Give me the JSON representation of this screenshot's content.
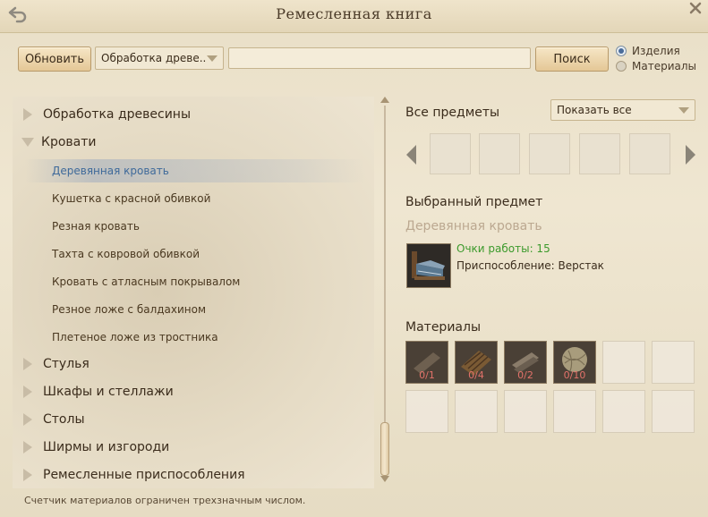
{
  "window": {
    "title": "Ремесленная книга"
  },
  "toolbar": {
    "refresh_label": "Обновить",
    "category_dropdown": "Обработка древе..",
    "search_value": "",
    "search_button": "Поиск",
    "radio_options": [
      {
        "label": "Изделия",
        "checked": true
      },
      {
        "label": "Материалы",
        "checked": false
      }
    ]
  },
  "tree": {
    "categories": [
      {
        "label": "Обработка древесины",
        "expanded": false
      },
      {
        "label": "Кровати",
        "expanded": true
      },
      {
        "label": "Стулья",
        "expanded": false
      },
      {
        "label": "Шкафы и стеллажи",
        "expanded": false
      },
      {
        "label": "Столы",
        "expanded": false
      },
      {
        "label": "Ширмы и изгороди",
        "expanded": false
      },
      {
        "label": "Ремесленные приспособления",
        "expanded": false
      }
    ],
    "subitems": [
      {
        "label": "Деревянная кровать",
        "selected": true
      },
      {
        "label": "Кушетка с красной обивкой",
        "selected": false
      },
      {
        "label": "Резная кровать",
        "selected": false
      },
      {
        "label": "Тахта с ковровой обивкой",
        "selected": false
      },
      {
        "label": "Кровать с атласным покрывалом",
        "selected": false
      },
      {
        "label": "Резное ложе с балдахином",
        "selected": false
      },
      {
        "label": "Плетеное ложе из тростника",
        "selected": false
      }
    ]
  },
  "right": {
    "all_items_heading": "Все предметы",
    "filter_dropdown": "Показать все",
    "selected_heading": "Выбранный предмет",
    "selected_name": "Деревянная кровать",
    "work_points": "Очки работы: 15",
    "tool": "Приспособление: Верстак",
    "materials_heading": "Материалы",
    "materials": [
      {
        "count": "0/1",
        "icon": "plank-icon"
      },
      {
        "count": "0/4",
        "icon": "timber-icon"
      },
      {
        "count": "0/2",
        "icon": "board-icon"
      },
      {
        "count": "0/10",
        "icon": "thread-ball-icon"
      }
    ]
  },
  "footer": {
    "note": "Счетчик материалов ограничен трехзначным числом."
  },
  "colors": {
    "accent_blue": "#3f6a9a",
    "green_text": "#3c9a2c",
    "count_red": "#e3726a"
  }
}
